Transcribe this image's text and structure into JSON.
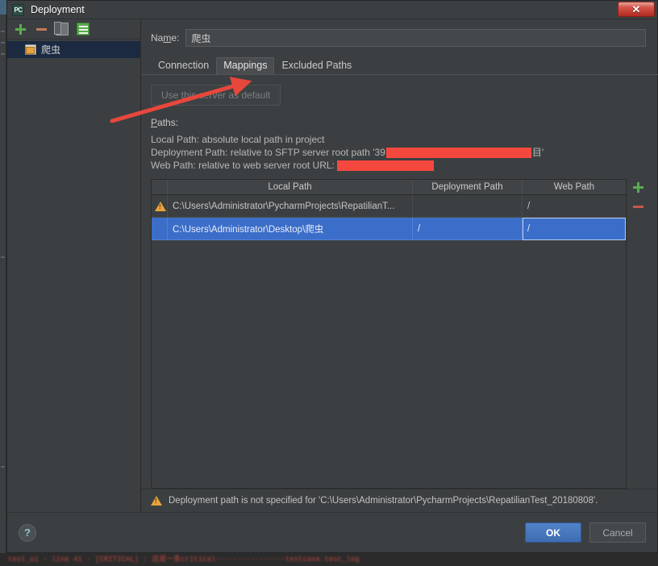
{
  "window": {
    "title": "Deployment",
    "app_icon": "pycharm-icon",
    "app_icon_text": "PC",
    "close_label": "✕"
  },
  "sidebar": {
    "toolbar": [
      {
        "name": "add-server-button",
        "icon": "plus-icon",
        "label": "+"
      },
      {
        "name": "remove-server-button",
        "icon": "minus-icon",
        "label": "–"
      },
      {
        "name": "copy-server-button",
        "icon": "copy-icon",
        "label": "Copy"
      },
      {
        "name": "set-default-button",
        "icon": "deploy-icon",
        "label": "Default"
      }
    ],
    "items": [
      {
        "label": "爬虫",
        "icon": "server-icon",
        "selected": true
      }
    ]
  },
  "form": {
    "name_label_pre": "Na",
    "name_label_mnemonic": "m",
    "name_label_post": "e:",
    "name_value": "爬虫",
    "name_placeholder": ""
  },
  "tabs": [
    {
      "label": "Connection",
      "active": false
    },
    {
      "label": "Mappings",
      "active": true
    },
    {
      "label": "Excluded Paths",
      "active": false
    }
  ],
  "mappings": {
    "default_server_button": "Use this server as default",
    "paths_heading_mnemonic": "P",
    "paths_heading_rest": "aths:",
    "descriptions": [
      {
        "text": "Local Path: absolute local path in project",
        "redactions": []
      },
      {
        "text": "Deployment Path: relative to SFTP server root path '39",
        "redactions": [
          {
            "width": 180
          }
        ],
        "suffix": "目'"
      },
      {
        "text": "Web Path: relative to web server root URL:",
        "redactions": [
          {
            "width": 120
          }
        ],
        "suffix": ""
      }
    ],
    "table": {
      "columns": [
        "",
        "Local Path",
        "Deployment Path",
        "Web Path"
      ],
      "rows": [
        {
          "warning": true,
          "local_path": "C:\\Users\\Administrator\\PycharmProjects\\RepatilianT...",
          "deployment_path": "",
          "web_path": "/",
          "selected": false,
          "focused_cell": null
        },
        {
          "warning": false,
          "local_path": "C:\\Users\\Administrator\\Desktop\\爬虫",
          "deployment_path": "/",
          "web_path": "/",
          "selected": true,
          "focused_cell": "web_path"
        }
      ],
      "add_row_button": "+",
      "remove_row_button": "–"
    },
    "validation_warning": "Deployment path is not specified for 'C:\\Users\\Administrator\\PycharmProjects\\RepatilianTest_20180808'."
  },
  "footer": {
    "help_label": "?",
    "ok_label": "OK",
    "cancel_label": "Cancel"
  },
  "console": {
    "line": "test_ui - line 41 - [CRITICAL] : 这是一条critical----------------testcase.test_log"
  },
  "colors": {
    "dialog_bg": "#3c3f41",
    "selection_blue": "#3b6ec9",
    "tree_selection": "#1b2a40",
    "accent_green": "#5aaa4e",
    "warning_amber": "#e8a33d",
    "redaction_red": "#f4483f",
    "arrow_red": "#e8473c",
    "ok_blue": "#3f6cb0"
  }
}
